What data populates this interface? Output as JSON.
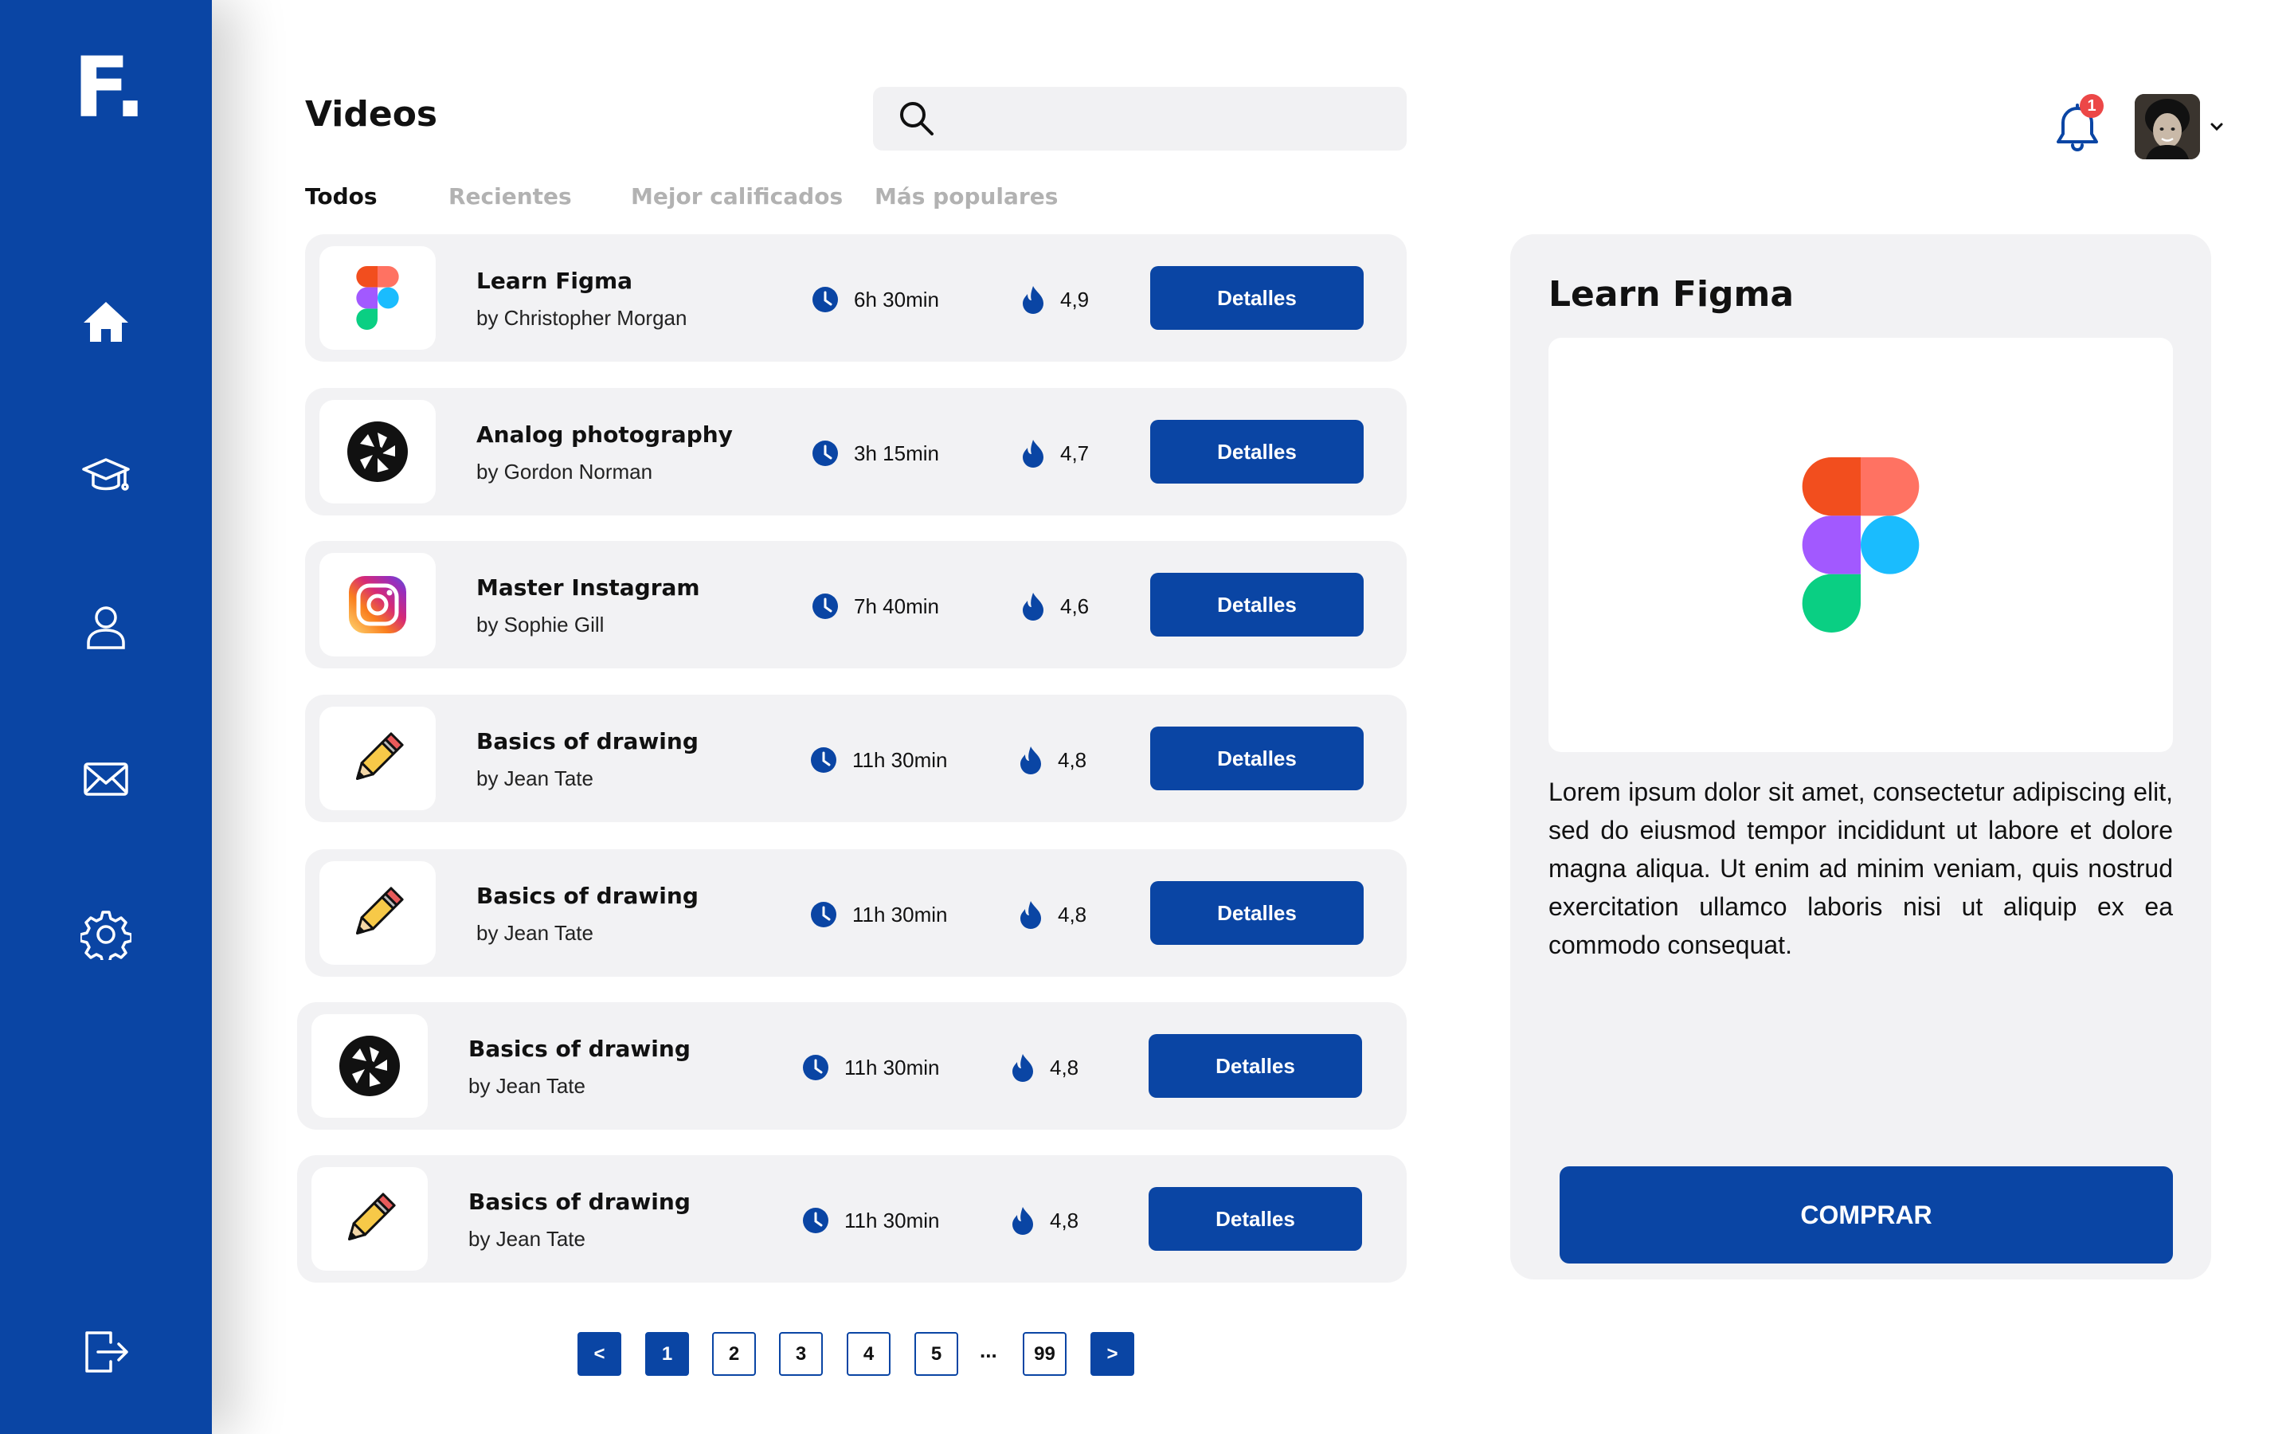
{
  "app": {
    "logo_text": "F."
  },
  "sidebar": {
    "items": [
      {
        "name": "home",
        "icon": "home-icon"
      },
      {
        "name": "courses",
        "icon": "graduation-cap-icon"
      },
      {
        "name": "profile",
        "icon": "user-icon"
      },
      {
        "name": "messages",
        "icon": "mail-icon"
      },
      {
        "name": "settings",
        "icon": "gear-icon"
      }
    ],
    "logout_icon": "logout-icon",
    "bg_color": "#0a45a4"
  },
  "header": {
    "title": "Videos",
    "search": {
      "placeholder": "",
      "value": ""
    },
    "notifications_count": "1"
  },
  "tabs": [
    {
      "label": "Todos",
      "active": true
    },
    {
      "label": "Recientes",
      "active": false
    },
    {
      "label": "Mejor calificados",
      "active": false
    },
    {
      "label": "Más populares",
      "active": false
    }
  ],
  "courses": [
    {
      "title": "Learn Figma",
      "author": "by Christopher Morgan",
      "duration": "6h 30min",
      "rating": "4,9",
      "button": "Detalles",
      "icon": "figma-logo-icon"
    },
    {
      "title": "Analog photography",
      "author": "by Gordon Norman",
      "duration": "3h 15min",
      "rating": "4,7",
      "button": "Detalles",
      "icon": "camera-aperture-icon"
    },
    {
      "title": "Master Instagram",
      "author": "by Sophie Gill",
      "duration": "7h 40min",
      "rating": "4,6",
      "button": "Detalles",
      "icon": "instagram-logo-icon"
    },
    {
      "title": "Basics of drawing",
      "author": "by Jean Tate",
      "duration": "11h 30min",
      "rating": "4,8",
      "button": "Detalles",
      "icon": "pencil-icon"
    },
    {
      "title": "Basics of drawing",
      "author": "by Jean Tate",
      "duration": "11h 30min",
      "rating": "4,8",
      "button": "Detalles",
      "icon": "pencil-icon"
    },
    {
      "title": "Basics of drawing",
      "author": "by Jean Tate",
      "duration": "11h 30min",
      "rating": "4,8",
      "button": "Detalles",
      "icon": "camera-aperture-icon"
    },
    {
      "title": "Basics of drawing",
      "author": "by Jean Tate",
      "duration": "11h 30min",
      "rating": "4,8",
      "button": "Detalles",
      "icon": "pencil-icon"
    }
  ],
  "pagination": {
    "prev": "<",
    "next": ">",
    "pages": [
      "1",
      "2",
      "3",
      "4",
      "5"
    ],
    "ellipsis": "...",
    "last": "99",
    "current": "1"
  },
  "detail": {
    "title": "Learn Figma",
    "description": "Lorem ipsum dolor sit amet, consectetur adipiscing elit, sed do eiusmod tempor incididunt ut labore et dolore magna aliqua. Ut enim ad minim veniam, quis nostrud exercitation ullamco laboris nisi ut aliquip ex ea commodo consequat.",
    "buy_label": "COMPRAR",
    "image_icon": "figma-logo-icon"
  },
  "colors": {
    "primary": "#0a45a4",
    "card_bg": "#f2f2f4",
    "badge": "#ec4747",
    "muted_text": "#b2b2b2"
  }
}
